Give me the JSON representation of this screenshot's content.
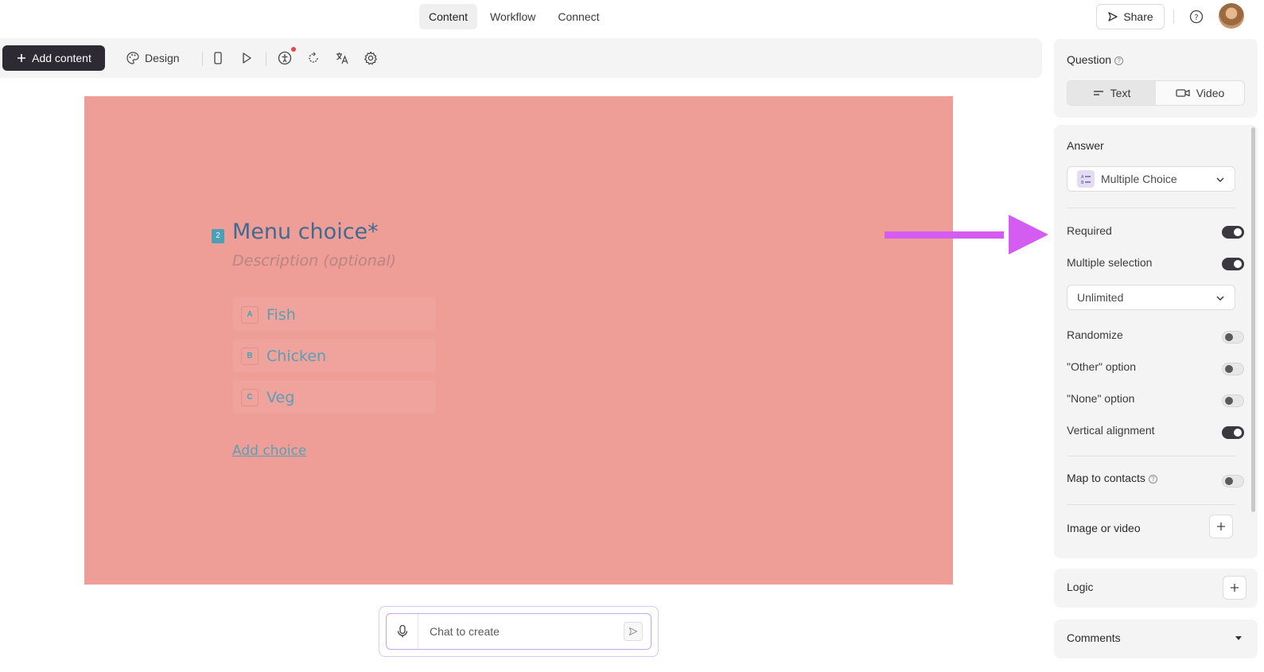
{
  "nav": {
    "tabs": [
      {
        "label": "Content",
        "active": true
      },
      {
        "label": "Workflow",
        "active": false
      },
      {
        "label": "Connect",
        "active": false
      }
    ],
    "share_label": "Share"
  },
  "toolbar": {
    "add_content_label": "Add content",
    "design_label": "Design",
    "icons": [
      "mobile-icon",
      "play-icon",
      "accessibility-icon",
      "refresh-icon",
      "translate-icon",
      "settings-icon"
    ]
  },
  "canvas": {
    "background": "#ef9e97",
    "question_number": "2",
    "title": "Menu choice*",
    "description_placeholder": "Description (optional)",
    "choices": [
      {
        "key": "A",
        "label": "Fish"
      },
      {
        "key": "B",
        "label": "Chicken"
      },
      {
        "key": "C",
        "label": "Veg"
      }
    ],
    "add_choice_label": "Add choice"
  },
  "chat": {
    "placeholder": "Chat to create"
  },
  "panel": {
    "question": {
      "label": "Question",
      "modes": [
        {
          "label": "Text",
          "active": true
        },
        {
          "label": "Video",
          "active": false
        }
      ]
    },
    "answer": {
      "label": "Answer",
      "type_value": "Multiple Choice",
      "required_label": "Required",
      "required": true,
      "multiple_selection_label": "Multiple selection",
      "multiple_selection": true,
      "limit_value": "Unlimited",
      "randomize_label": "Randomize",
      "randomize": false,
      "other_label": "\"Other\" option",
      "other": false,
      "none_label": "\"None\" option",
      "none": false,
      "vertical_label": "Vertical alignment",
      "vertical": true,
      "map_contacts_label": "Map to contacts",
      "map_contacts": false,
      "image_video_label": "Image or video"
    },
    "logic_label": "Logic",
    "comments_label": "Comments"
  },
  "annotation": {
    "arrow_color": "#d45cf0"
  }
}
